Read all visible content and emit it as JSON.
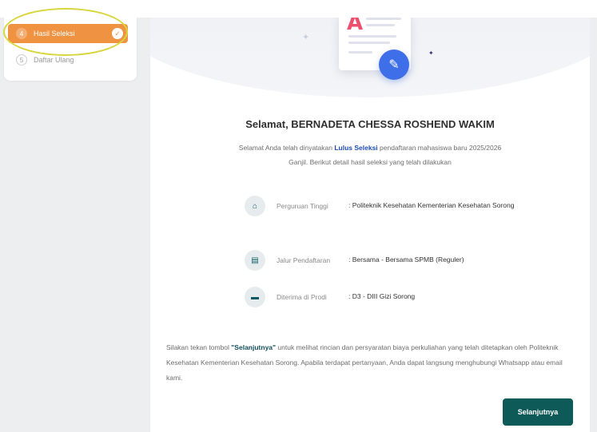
{
  "steps": [
    {
      "number": "4",
      "label": "Hasil Seleksi",
      "state": "active",
      "done_icon": "check-circle-icon"
    },
    {
      "number": "5",
      "label": "Daftar Ulang",
      "state": "idle"
    }
  ],
  "illustration": {
    "letter": "A",
    "icons": [
      "document-icon",
      "pencil-icon",
      "sparkle-icon"
    ]
  },
  "result": {
    "title": "Selamat, BERNADETA CHESSA ROSHEND WAKIM",
    "lead_before": "Selamat Anda telah dinyatakan ",
    "lead_highlight": "Lulus Seleksi",
    "lead_after": " pendaftaran mahasiswa baru 2025/2026 Ganjil. Berikut detail hasil seleksi yang telah dilakukan"
  },
  "details": [
    {
      "icon": "home-icon",
      "label": "Perguruan Tinggi",
      "value": ": Politeknik Kesehatan Kementerian Kesehatan Sorong"
    },
    {
      "icon": "file-icon",
      "label": "Jalur Pendaftaran",
      "value": ": Bersama - Bersama SPMB (Reguler)"
    },
    {
      "icon": "folder-icon",
      "label": "Diterima di Prodi",
      "value": ": D3 - DIII Gizi Sorong"
    }
  ],
  "note": {
    "before": "Silakan tekan tombol ",
    "highlight": "\"Selanjutnya\"",
    "after": " untuk melihat rincian dan persyaratan biaya perkuliahan yang telah ditetapkan oleh Politeknik Kesehatan Kementerian Kesehatan Sorong. Apabila terdapat pertanyaan, Anda dapat langsung menghubungi Whatsapp atau email kami."
  },
  "actions": {
    "next_label": "Selanjutnya"
  },
  "colors": {
    "step_active": "#ef9241",
    "primary": "#0e5a58",
    "link": "#1d4cb3",
    "accent_letter": "#ef4f6f",
    "pen": "#3f6fe8"
  }
}
